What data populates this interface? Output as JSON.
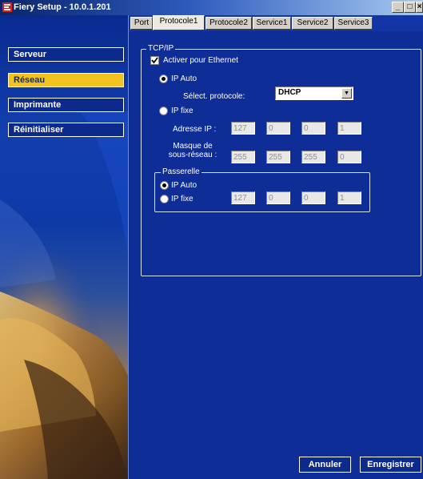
{
  "window": {
    "title": "Fiery Setup - 10.0.1.201",
    "controls": {
      "minimize": "_",
      "maximize": "□",
      "close": "×"
    }
  },
  "sidebar": {
    "items": [
      {
        "label": "Serveur"
      },
      {
        "label": "Réseau"
      },
      {
        "label": "Imprimante"
      },
      {
        "label": "Réinitialiser"
      }
    ],
    "active_item": "Réseau"
  },
  "tabs": [
    {
      "label": "Port"
    },
    {
      "label": "Protocole1"
    },
    {
      "label": "Protocole2"
    },
    {
      "label": "Service1"
    },
    {
      "label": "Service2"
    },
    {
      "label": "Service3"
    }
  ],
  "active_tab": "Protocole1",
  "tcpip": {
    "legend": "TCP/IP",
    "enable_label": "Activer pour Ethernet",
    "enable_checked": true,
    "ip_auto_label": "IP Auto",
    "protocol_label": "Sélect. protocole:",
    "protocol_value": "DHCP",
    "ip_fixe_label": "IP fixe",
    "address_label": "Adresse IP :",
    "address": [
      "127",
      "0",
      "0",
      "1"
    ],
    "mask_label_line1": "Masque de",
    "mask_label_line2": "sous-réseau :",
    "mask": [
      "255",
      "255",
      "255",
      "0"
    ],
    "selected_mode": "IP Auto"
  },
  "gateway": {
    "legend": "Passerelle",
    "ip_auto_label": "IP Auto",
    "ip_fixe_label": "IP fixe",
    "address": [
      "127",
      "0",
      "0",
      "1"
    ],
    "selected_mode": "IP Auto"
  },
  "footer": {
    "cancel_label": "Annuler",
    "save_label": "Enregistrer"
  },
  "colors": {
    "titlebar": "#0a246a",
    "background": "#0e2d96",
    "active_nav": "#f2c21e"
  }
}
